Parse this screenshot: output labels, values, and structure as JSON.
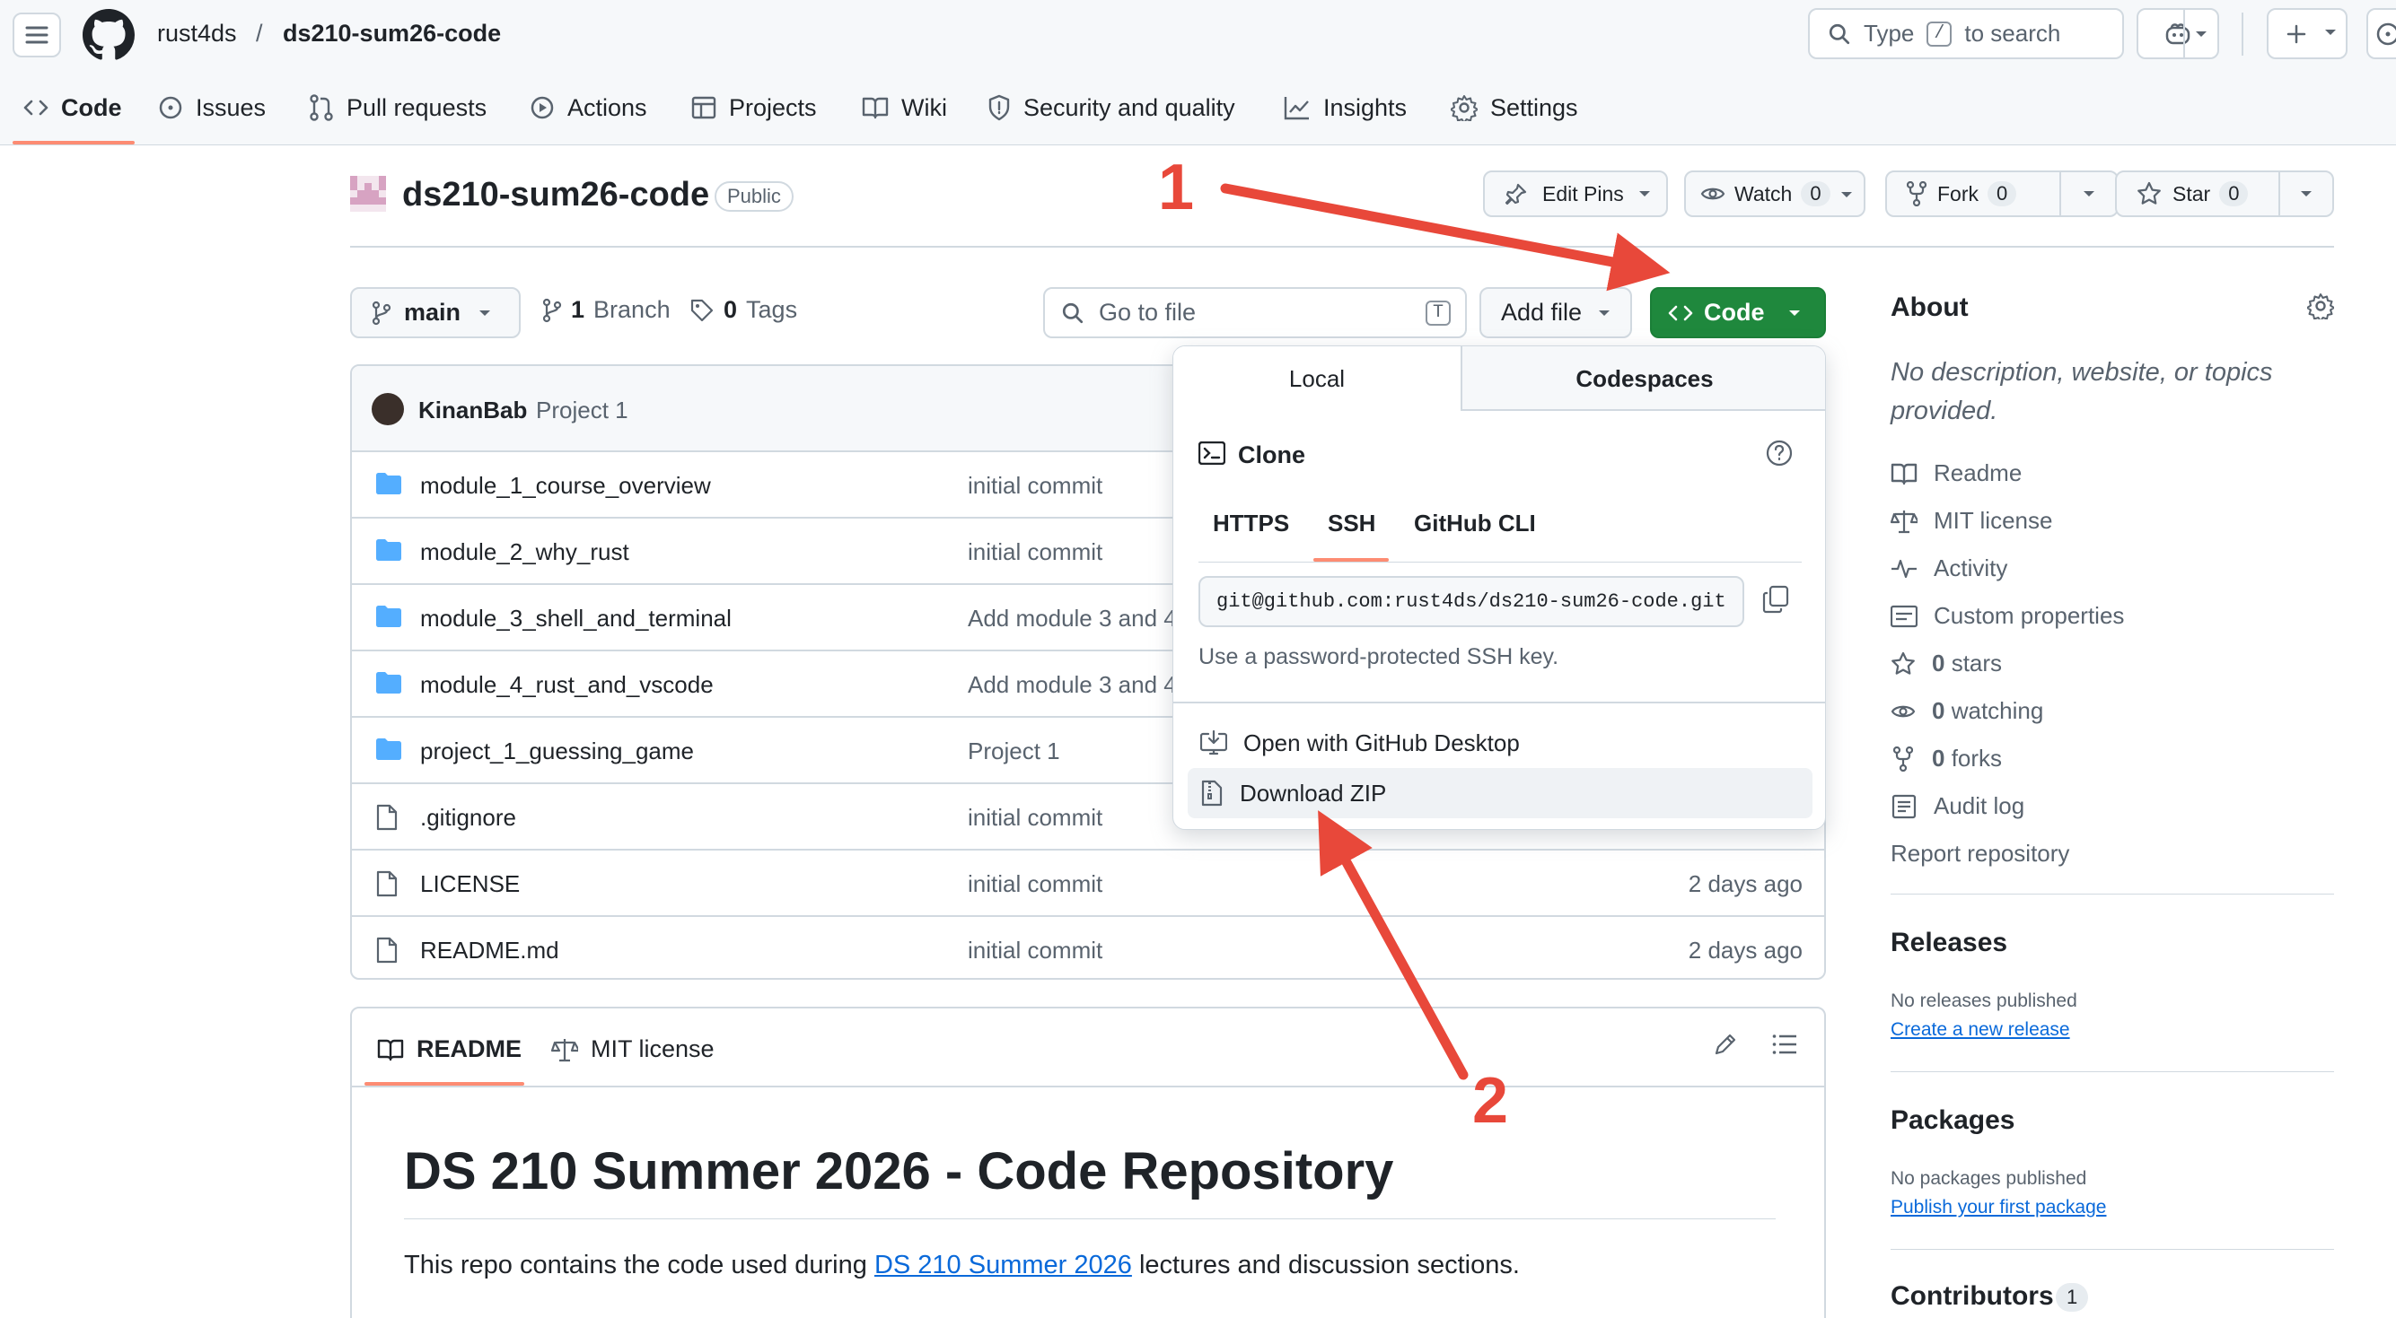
{
  "header": {
    "owner": "rust4ds",
    "separator": "/",
    "repo": "ds210-sum26-code",
    "search": {
      "prefix": "Type",
      "key": "/",
      "suffix": "to search"
    }
  },
  "tabs": [
    {
      "label": "Code",
      "icon": "code-icon"
    },
    {
      "label": "Issues",
      "icon": "issue-icon"
    },
    {
      "label": "Pull requests",
      "icon": "pull-request-icon"
    },
    {
      "label": "Actions",
      "icon": "play-icon"
    },
    {
      "label": "Projects",
      "icon": "table-icon"
    },
    {
      "label": "Wiki",
      "icon": "book-icon"
    },
    {
      "label": "Security and quality",
      "icon": "shield-icon"
    },
    {
      "label": "Insights",
      "icon": "graph-icon"
    },
    {
      "label": "Settings",
      "icon": "gear-icon"
    }
  ],
  "repo_header": {
    "title": "ds210-sum26-code",
    "visibility": "Public",
    "edit_pins": "Edit Pins",
    "watch": "Watch",
    "watch_count": "0",
    "fork": "Fork",
    "fork_count": "0",
    "star": "Star",
    "star_count": "0"
  },
  "toolbar": {
    "branch": "main",
    "branches_count": "1",
    "branches_label": "Branch",
    "tags_count": "0",
    "tags_label": "Tags",
    "goto_placeholder": "Go to file",
    "goto_key": "T",
    "add_file": "Add file",
    "code": "Code"
  },
  "latest_commit": {
    "author": "KinanBab",
    "message": "Project 1"
  },
  "files": [
    {
      "name": "module_1_course_overview",
      "type": "folder",
      "message": "initial commit",
      "date": ""
    },
    {
      "name": "module_2_why_rust",
      "type": "folder",
      "message": "initial commit",
      "date": ""
    },
    {
      "name": "module_3_shell_and_terminal",
      "type": "folder",
      "message": "Add module 3 and 4",
      "date": ""
    },
    {
      "name": "module_4_rust_and_vscode",
      "type": "folder",
      "message": "Add module 3 and 4",
      "date": ""
    },
    {
      "name": "project_1_guessing_game",
      "type": "folder",
      "message": "Project 1",
      "date": ""
    },
    {
      "name": ".gitignore",
      "type": "file",
      "message": "initial commit",
      "date": ""
    },
    {
      "name": "LICENSE",
      "type": "file",
      "message": "initial commit",
      "date": "2 days ago"
    },
    {
      "name": "README.md",
      "type": "file",
      "message": "initial commit",
      "date": "2 days ago"
    }
  ],
  "readme": {
    "tab_readme": "README",
    "tab_license": "MIT license",
    "heading": "DS 210 Summer 2026 - Code Repository",
    "para_before": "This repo contains the code used during ",
    "para_link": "DS 210 Summer 2026",
    "para_after": " lectures and discussion sections."
  },
  "code_dropdown": {
    "tab_local": "Local",
    "tab_codespaces": "Codespaces",
    "clone_title": "Clone",
    "protocols": [
      "HTTPS",
      "SSH",
      "GitHub CLI"
    ],
    "active_protocol": "SSH",
    "url": "git@github.com:rust4ds/ds210-sum26-code.git",
    "hint": "Use a password-protected SSH key.",
    "open_desktop": "Open with GitHub Desktop",
    "download_zip": "Download ZIP"
  },
  "sidebar": {
    "about_title": "About",
    "description": "No description, website, or topics provided.",
    "items": [
      {
        "icon": "book-icon",
        "prefix": "",
        "label": "Readme"
      },
      {
        "icon": "law-icon",
        "prefix": "",
        "label": "MIT license"
      },
      {
        "icon": "pulse-icon",
        "prefix": "",
        "label": "Activity"
      },
      {
        "icon": "note-icon",
        "prefix": "",
        "label": "Custom properties"
      },
      {
        "icon": "star-icon",
        "prefix": "0",
        "label": "stars"
      },
      {
        "icon": "eye-icon",
        "prefix": "0",
        "label": "watching"
      },
      {
        "icon": "fork-icon",
        "prefix": "0",
        "label": "forks"
      },
      {
        "icon": "log-icon",
        "prefix": "",
        "label": "Audit log"
      }
    ],
    "report": "Report repository",
    "releases_title": "Releases",
    "releases_none": "No releases published",
    "releases_link": "Create a new release",
    "packages_title": "Packages",
    "packages_none": "No packages published",
    "packages_link": "Publish your first package",
    "contributors_title": "Contributors",
    "contributors_count": "1"
  },
  "annotations": {
    "step1": "1",
    "step2": "2",
    "arrow_color": "#e8483a"
  },
  "colors": {
    "primary_green": "#1f883d",
    "link_blue": "#0969da",
    "tab_underline": "#fd8c73",
    "folder_blue": "#54aeff"
  }
}
